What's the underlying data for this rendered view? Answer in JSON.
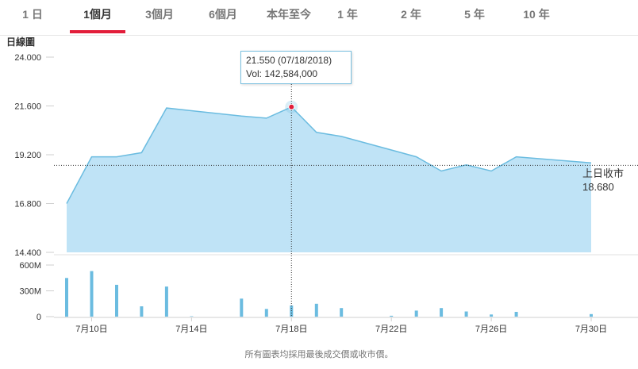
{
  "tabs": [
    {
      "label": "1 日",
      "active": false
    },
    {
      "label": "1個月",
      "active": true
    },
    {
      "label": "3個月",
      "active": false
    },
    {
      "label": "6個月",
      "active": false
    },
    {
      "label": "本年至今",
      "active": false
    },
    {
      "label": "1 年",
      "active": false
    },
    {
      "label": "2 年",
      "active": false
    },
    {
      "label": "5 年",
      "active": false
    },
    {
      "label": "10 年",
      "active": false
    }
  ],
  "chart_data": {
    "type": "area",
    "title": "日線圖",
    "ylim": [
      14.4,
      24.0
    ],
    "yticks": [
      "24.000",
      "21.600",
      "19.200",
      "16.800",
      "14.400"
    ],
    "volume_ylim": [
      0,
      600
    ],
    "volume_ticks": [
      "600M",
      "300M",
      "0"
    ],
    "x_tick_labels": [
      "7月10日",
      "7月14日",
      "7月18日",
      "7月22日",
      "7月26日",
      "7月30日"
    ],
    "x_tick_days": [
      10,
      14,
      18,
      22,
      26,
      30
    ],
    "price_series": {
      "name": "",
      "x": [
        9,
        10,
        11,
        12,
        13,
        16,
        17,
        18,
        19,
        20,
        23,
        24,
        25,
        26,
        27,
        30
      ],
      "y": [
        16.8,
        19.1,
        19.1,
        19.3,
        21.5,
        21.1,
        21.0,
        21.55,
        20.3,
        20.1,
        19.1,
        18.4,
        18.7,
        18.4,
        19.1,
        18.8
      ]
    },
    "volume_series": {
      "name": "",
      "x": [
        9,
        10,
        11,
        12,
        13,
        14,
        16,
        17,
        18,
        19,
        20,
        22,
        23,
        24,
        25,
        26,
        27,
        30
      ],
      "values": [
        450,
        530,
        370,
        120,
        350,
        5,
        210,
        90,
        130,
        150,
        100,
        10,
        70,
        100,
        60,
        25,
        55,
        30
      ]
    },
    "previous_close": {
      "label": "上日收市",
      "value": "18.680",
      "level": 18.68
    },
    "tooltip": {
      "line1": "21.550 (07/18/2018)",
      "line2": "Vol: 142,584,000",
      "day": 18,
      "price": 21.55
    },
    "colors": {
      "line": "#6bbce0",
      "area": "#bfe3f6",
      "bars": "#6bbce0",
      "marker": "#e21d3a",
      "tab_indicator": "#e21d3a"
    },
    "grid": false,
    "legend": "none"
  },
  "footer": "所有圖表均採用最後成交價或收市價。"
}
